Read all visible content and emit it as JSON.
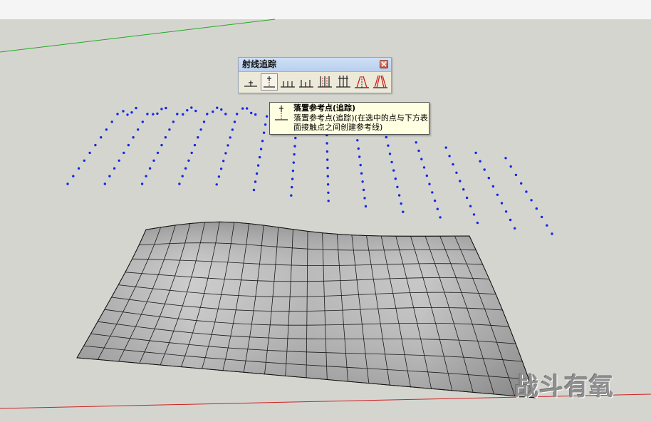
{
  "palette": {
    "title": "射线追踪",
    "tools": [
      {
        "name": "ray-trace-tool-1"
      },
      {
        "name": "drop-reference-point-tool"
      },
      {
        "name": "ray-trace-tool-3"
      },
      {
        "name": "ray-trace-tool-4"
      },
      {
        "name": "ray-trace-tool-5"
      },
      {
        "name": "ray-trace-tool-6"
      },
      {
        "name": "ray-trace-tool-7"
      },
      {
        "name": "ray-trace-tool-8"
      }
    ],
    "active_tool_index": 1
  },
  "tooltip": {
    "title": "落置参考点(追踪)",
    "description": "落置参考点(追踪)(在选中的点与下方表面接触点之间创建参考线)"
  },
  "watermark": "战斗有氧",
  "colors": {
    "background": "#d5d5d0",
    "points": "#1428e6",
    "surface": "#a9a9a9",
    "green_axis": "#22aa22",
    "red_axis": "#cc2222",
    "tooltip_bg": "#ffffe1"
  }
}
